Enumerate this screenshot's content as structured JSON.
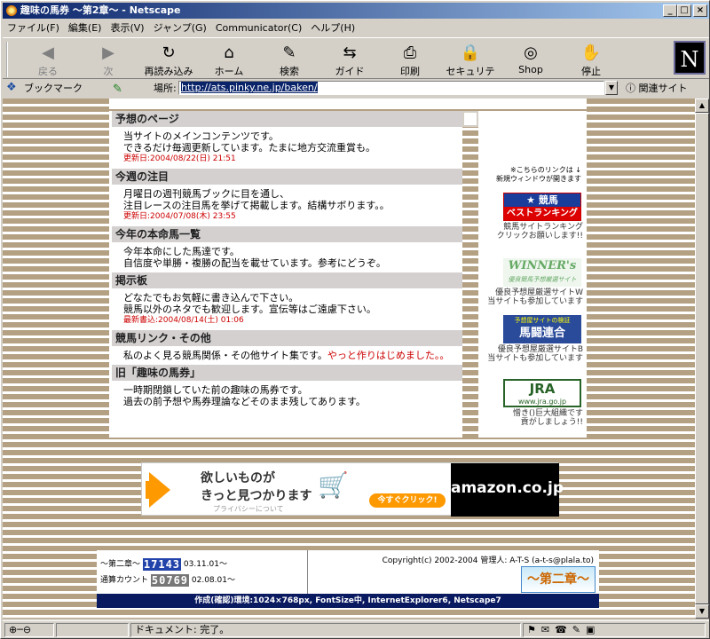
{
  "window": {
    "title": "趣味の馬券 ～第2章～ - Netscape"
  },
  "menu": [
    "ファイル(F)",
    "編集(E)",
    "表示(V)",
    "ジャンプ(G)",
    "Communicator(C)",
    "ヘルプ(H)"
  ],
  "toolbar": [
    {
      "label": "戻る",
      "icon": "back-icon",
      "glyph": "◀",
      "disabled": true
    },
    {
      "label": "次",
      "icon": "forward-icon",
      "glyph": "▶",
      "disabled": true
    },
    {
      "label": "再読み込み",
      "icon": "reload-icon",
      "glyph": "↻",
      "disabled": false
    },
    {
      "label": "ホーム",
      "icon": "home-icon",
      "glyph": "⌂",
      "disabled": false
    },
    {
      "label": "検索",
      "icon": "search-icon",
      "glyph": "✎",
      "disabled": false
    },
    {
      "label": "ガイド",
      "icon": "guide-icon",
      "glyph": "⇆",
      "disabled": false
    },
    {
      "label": "印刷",
      "icon": "print-icon",
      "glyph": "⎙",
      "disabled": false
    },
    {
      "label": "セキュリティ",
      "icon": "lock-icon",
      "glyph": "🔒",
      "disabled": false
    },
    {
      "label": "Shop",
      "icon": "shop-icon",
      "glyph": "◎",
      "disabled": false
    },
    {
      "label": "停止",
      "icon": "stop-icon",
      "glyph": "✋",
      "disabled": false
    }
  ],
  "location": {
    "bookmark_label": "ブックマーク",
    "label": "場所:",
    "url": "http://ats.pinky.ne.jp/baken/",
    "related": "関連サイト"
  },
  "sections": [
    {
      "title": "予想のページ",
      "lines": [
        "当サイトのメインコンテンツです。",
        "できるだけ毎週更新しています。たまに地方交流重賞も。"
      ],
      "date": "更新日:2004/08/22(日) 21:51"
    },
    {
      "title": "今週の注目",
      "lines": [
        "月曜日の週刊競馬ブックに目を通し、",
        "注目レースの注目馬を挙げて掲載します。結構サボります。。"
      ],
      "date": "更新日:2004/07/08(木) 23:55"
    },
    {
      "title": "今年の本命馬一覧",
      "lines": [
        "今年本命にした馬達です。",
        "自信度や単勝・複勝の配当を載せています。参考にどうぞ。"
      ],
      "date": ""
    },
    {
      "title": "掲示板",
      "lines": [
        "どなたでもお気軽に書き込んで下さい。",
        "競馬以外のネタでも歓迎します。宣伝等はご遠慮下さい。"
      ],
      "date": "最新書込:2004/08/14(土) 01:06"
    },
    {
      "title": "競馬リンク・その他",
      "lines": [
        "私のよく見る競馬関係・その他サイト集です。"
      ],
      "extra": "やっと作りはじめました。。",
      "date": ""
    },
    {
      "title": "旧「趣味の馬券」",
      "lines": [
        "一時期閉鎖していた前の趣味の馬券です。",
        "過去の前予想や馬券理論などそのまま残してあります。"
      ],
      "date": ""
    }
  ],
  "sidebar": {
    "note": [
      "※こちらのリンクは ↓",
      "新規ウィンドウが開きます"
    ],
    "banners": [
      {
        "text": "★ 競馬\nベストランキング",
        "caption": [
          "競馬サイトランキング",
          "クリックお願いします!!"
        ]
      },
      {
        "text": "WINNER's\n優良競馬予想厳選サイト",
        "caption": [
          "優良予想屋厳選サイトW",
          "当サイトも参加しています"
        ]
      },
      {
        "text": "予想屋サイトの検証\n馬闘連合",
        "caption": [
          "優良予想屋厳選サイトB",
          "当サイトも参加しています"
        ]
      },
      {
        "text": "JRA\nwww.jra.go.jp",
        "caption": [
          "憎き()巨大組織です",
          "貢がしましょう!!"
        ]
      }
    ]
  },
  "ad": {
    "line1": "欲しいものが",
    "line2": "きっと見つかります",
    "privacy": "プライバシーについて",
    "click": "今すぐクリック!",
    "logo": "amazon.co.jp"
  },
  "footer": {
    "counter1_label": "～第二章～",
    "counter1": "17143",
    "counter1_date": "03.11.01～",
    "counter2_label": "通算カウント",
    "counter2": "50769",
    "counter2_date": "02.08.01～",
    "copyright": "Copyright(c) 2002-2004 管理人: A-T-S (a-t-s@plala.to)",
    "badge": "～第二章～",
    "env": "作成(確認)環境:1024×768px, FontSize中, InternetExplorer6, Netscape7"
  },
  "status": {
    "text": "ドキュメント: 完了。"
  }
}
